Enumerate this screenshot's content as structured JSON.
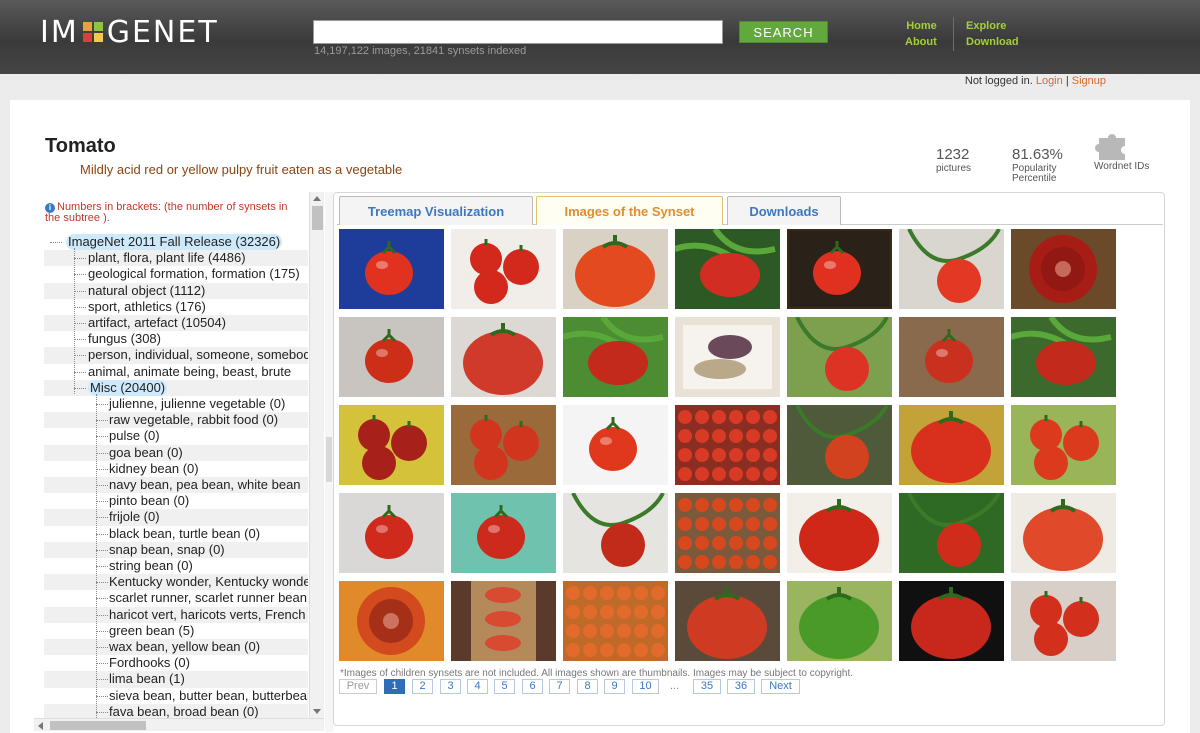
{
  "header": {
    "logo_left": "IM",
    "logo_right": "GENET",
    "logo_colors": [
      "#e8a23a",
      "#8cc63f",
      "#d9403a",
      "#f2c94c"
    ],
    "search_button": "SEARCH",
    "search_value": "",
    "index_stats": "14,197,122 images, 21841 synsets indexed",
    "nav": {
      "home": "Home",
      "about": "About",
      "explore": "Explore",
      "download": "Download"
    },
    "login": {
      "prefix": "Not logged in.",
      "login": "Login",
      "sep": "|",
      "signup": "Signup"
    }
  },
  "synset": {
    "title": "Tomato",
    "gloss": "Mildly acid red or yellow pulpy fruit eaten as a vegetable",
    "stats": [
      {
        "value": "1232",
        "label": "pictures"
      },
      {
        "value": "81.63%",
        "label": "Popularity Percentile"
      },
      {
        "value": "",
        "label": "Wordnet IDs"
      }
    ]
  },
  "tree": {
    "note": "Numbers in brackets: (the number of synsets in the subtree ).",
    "rows": [
      {
        "label": "ImageNet 2011 Fall Release (32326)",
        "level": 0,
        "highlight": true
      },
      {
        "label": "plant, flora, plant life (4486)",
        "level": 1
      },
      {
        "label": "geological formation, formation (175)",
        "level": 1
      },
      {
        "label": "natural object (1112)",
        "level": 1
      },
      {
        "label": "sport, athletics (176)",
        "level": 1
      },
      {
        "label": "artifact, artefact (10504)",
        "level": 1
      },
      {
        "label": "fungus (308)",
        "level": 1
      },
      {
        "label": "person, individual, someone, somebody",
        "level": 1
      },
      {
        "label": "animal, animate being, beast, brute",
        "level": 1
      },
      {
        "label": "Misc (20400)",
        "level": 1,
        "highlight": true
      },
      {
        "label": "julienne, julienne vegetable (0)",
        "level": 2
      },
      {
        "label": "raw vegetable, rabbit food (0)",
        "level": 2
      },
      {
        "label": "pulse (0)",
        "level": 2
      },
      {
        "label": "goa bean (0)",
        "level": 2
      },
      {
        "label": "kidney bean (0)",
        "level": 2
      },
      {
        "label": "navy bean, pea bean, white bean",
        "level": 2
      },
      {
        "label": "pinto bean (0)",
        "level": 2
      },
      {
        "label": "frijole (0)",
        "level": 2
      },
      {
        "label": "black bean, turtle bean (0)",
        "level": 2
      },
      {
        "label": "snap bean, snap (0)",
        "level": 2
      },
      {
        "label": "string bean (0)",
        "level": 2
      },
      {
        "label": "Kentucky wonder, Kentucky wonder",
        "level": 2
      },
      {
        "label": "scarlet runner, scarlet runner bean",
        "level": 2
      },
      {
        "label": "haricot vert, haricots verts, French",
        "level": 2
      },
      {
        "label": "green bean (5)",
        "level": 2
      },
      {
        "label": "wax bean, yellow bean (0)",
        "level": 2
      },
      {
        "label": "Fordhooks (0)",
        "level": 2
      },
      {
        "label": "lima bean (1)",
        "level": 2
      },
      {
        "label": "sieva bean, butter bean, butterbean",
        "level": 2
      },
      {
        "label": "fava bean, broad bean (0)",
        "level": 2
      }
    ]
  },
  "tabs": [
    {
      "label": "Treemap Visualization",
      "active": false
    },
    {
      "label": "Images of the Synset",
      "active": true
    },
    {
      "label": "Downloads",
      "active": false
    }
  ],
  "images": [
    {
      "name": "tomato-thumb",
      "bg": "#1e3d9a",
      "fg": "#e0321e",
      "kind": "round"
    },
    {
      "name": "tomato-thumb",
      "bg": "#f1eee9",
      "fg": "#d3281c",
      "kind": "cluster"
    },
    {
      "name": "tomato-thumb",
      "bg": "#d9d2c4",
      "fg": "#e44a1f",
      "kind": "big"
    },
    {
      "name": "tomato-thumb",
      "bg": "#2d5a24",
      "fg": "#d22d22",
      "kind": "leafy"
    },
    {
      "name": "tomato-thumb",
      "bg": "#2a2218",
      "fg": "#e0301f",
      "kind": "round",
      "selected": true
    },
    {
      "name": "tomato-thumb",
      "bg": "#d8d6cf",
      "fg": "#e23824",
      "kind": "vine"
    },
    {
      "name": "tomato-thumb",
      "bg": "#6b4a2a",
      "fg": "#a81c16",
      "kind": "slice"
    },
    {
      "name": "tomato-thumb",
      "bg": "#c8c4bf",
      "fg": "#cc2e18",
      "kind": "round"
    },
    {
      "name": "tomato-thumb",
      "bg": "#dcd8d3",
      "fg": "#d03a2a",
      "kind": "big"
    },
    {
      "name": "tomato-thumb",
      "bg": "#4c8c32",
      "fg": "#c42a1c",
      "kind": "leafy"
    },
    {
      "name": "tomato-thumb",
      "bg": "#e8e2d6",
      "fg": "#6a4a5a",
      "kind": "jar"
    },
    {
      "name": "tomato-thumb",
      "bg": "#7ca04e",
      "fg": "#dd3324",
      "kind": "vine"
    },
    {
      "name": "tomato-thumb",
      "bg": "#8a6a4c",
      "fg": "#c9301e",
      "kind": "round"
    },
    {
      "name": "tomato-thumb",
      "bg": "#3b6a2c",
      "fg": "#c22a1c",
      "kind": "leafy"
    },
    {
      "name": "tomato-thumb",
      "bg": "#d4c23a",
      "fg": "#a8201a",
      "kind": "cluster"
    },
    {
      "name": "tomato-thumb",
      "bg": "#9a6a3a",
      "fg": "#d2351e",
      "kind": "cluster"
    },
    {
      "name": "tomato-thumb",
      "bg": "#f4f4f4",
      "fg": "#e0381c",
      "kind": "round"
    },
    {
      "name": "tomato-thumb",
      "bg": "#8a2e22",
      "fg": "#d83a26",
      "kind": "grid"
    },
    {
      "name": "tomato-thumb",
      "bg": "#4e5a3a",
      "fg": "#d2421e",
      "kind": "vine"
    },
    {
      "name": "tomato-thumb",
      "bg": "#c4a23a",
      "fg": "#d8301c",
      "kind": "big"
    },
    {
      "name": "tomato-thumb",
      "bg": "#9ab45a",
      "fg": "#dc3a1c",
      "kind": "cluster"
    },
    {
      "name": "tomato-thumb",
      "bg": "#dad8d6",
      "fg": "#cf2a1c",
      "kind": "round"
    },
    {
      "name": "tomato-thumb",
      "bg": "#6ec2ae",
      "fg": "#cc2a1c",
      "kind": "round"
    },
    {
      "name": "tomato-thumb",
      "bg": "#e6e4e0",
      "fg": "#c22a1a",
      "kind": "vine"
    },
    {
      "name": "tomato-thumb",
      "bg": "#7a5a3a",
      "fg": "#d8481e",
      "kind": "grid"
    },
    {
      "name": "tomato-thumb",
      "bg": "#f2eee8",
      "fg": "#d02818",
      "kind": "big"
    },
    {
      "name": "tomato-thumb",
      "bg": "#2e6a24",
      "fg": "#d02c1c",
      "kind": "vine"
    },
    {
      "name": "tomato-thumb",
      "bg": "#eeeae4",
      "fg": "#e04a2a",
      "kind": "big"
    },
    {
      "name": "tomato-thumb",
      "bg": "#e08a2a",
      "fg": "#d24a1e",
      "kind": "slice"
    },
    {
      "name": "tomato-thumb",
      "bg": "#5a3a2a",
      "fg": "#d84a32",
      "kind": "stack"
    },
    {
      "name": "tomato-thumb",
      "bg": "#c06a2a",
      "fg": "#e26a2a",
      "kind": "grid"
    },
    {
      "name": "tomato-thumb",
      "bg": "#5a4a3a",
      "fg": "#cf3a22",
      "kind": "big"
    },
    {
      "name": "tomato-thumb",
      "bg": "#9ab460",
      "fg": "#4a9a2a",
      "kind": "big"
    },
    {
      "name": "tomato-thumb",
      "bg": "#101010",
      "fg": "#c8281c",
      "kind": "big"
    },
    {
      "name": "tomato-thumb",
      "bg": "#d8d0c8",
      "fg": "#d2301c",
      "kind": "cluster"
    }
  ],
  "disclaimer": "*Images of children synsets are not included. All images shown are thumbnails. Images may be subject to copyright.",
  "pagination": {
    "prev": "Prev",
    "pages": [
      "1",
      "2",
      "3",
      "4",
      "5",
      "6",
      "7",
      "8",
      "9",
      "10"
    ],
    "ellipsis": "...",
    "tail": [
      "35",
      "36"
    ],
    "next": "Next",
    "current": "1"
  }
}
